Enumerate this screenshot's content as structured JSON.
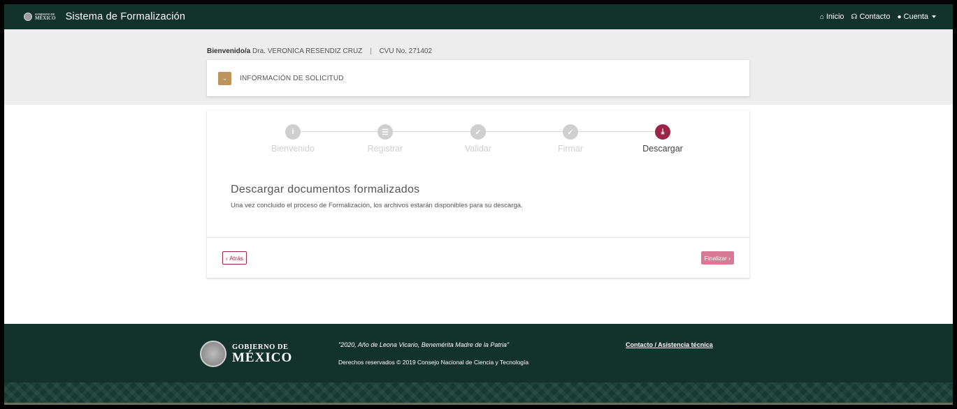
{
  "header": {
    "brand_small_line1": "GOBIERNO DE",
    "brand_small_line2": "MÉXICO",
    "app_title": "Sistema de Formalización",
    "nav": [
      {
        "label": "Inicio",
        "icon": "home-icon"
      },
      {
        "label": "Contacto",
        "icon": "support-icon"
      },
      {
        "label": "Cuenta",
        "icon": "user-icon"
      }
    ]
  },
  "welcome": {
    "prefix": "Bienvenido/a",
    "name": "Dra. VERONICA RESENDIZ CRUZ",
    "separator": "|",
    "cvu": "CVU No. 271402"
  },
  "info_panel": {
    "title": "INFORMACIÓN DE SOLICITUD"
  },
  "wizard": {
    "steps": [
      {
        "label": "Bienvenido",
        "icon": "info-icon",
        "glyph": "i"
      },
      {
        "label": "Registrar",
        "icon": "list-icon",
        "glyph": "☰"
      },
      {
        "label": "Validar",
        "icon": "check-icon",
        "glyph": "✓"
      },
      {
        "label": "Firmar",
        "icon": "check-icon",
        "glyph": "✓"
      },
      {
        "label": "Descargar",
        "icon": "download-icon",
        "glyph": "⤓"
      }
    ],
    "active_step": "Descargar",
    "section_title": "Descargar documentos formalizados",
    "section_desc": "Una vez concluido el proceso de Formalización, los archivos estarán disponibles para su descarga.",
    "back_label": "Atrás",
    "finish_label": "Finalizar"
  },
  "footer": {
    "logo_line1": "GOBIERNO DE",
    "logo_line2": "MÉXICO",
    "quote": "\"2020, Año de Leona Vicario, Benemérita Madre de la Patria\"",
    "rights": "Derechos reservados © 2019 Consejo Nacional de Ciencia y Tecnología",
    "contact_link": "Contacto / Asistencia técnica"
  },
  "colors": {
    "header_bg": "#13322b",
    "accent_gold": "#bc955c",
    "accent_wine": "#9d2449",
    "finish_button": "#d67a95"
  }
}
